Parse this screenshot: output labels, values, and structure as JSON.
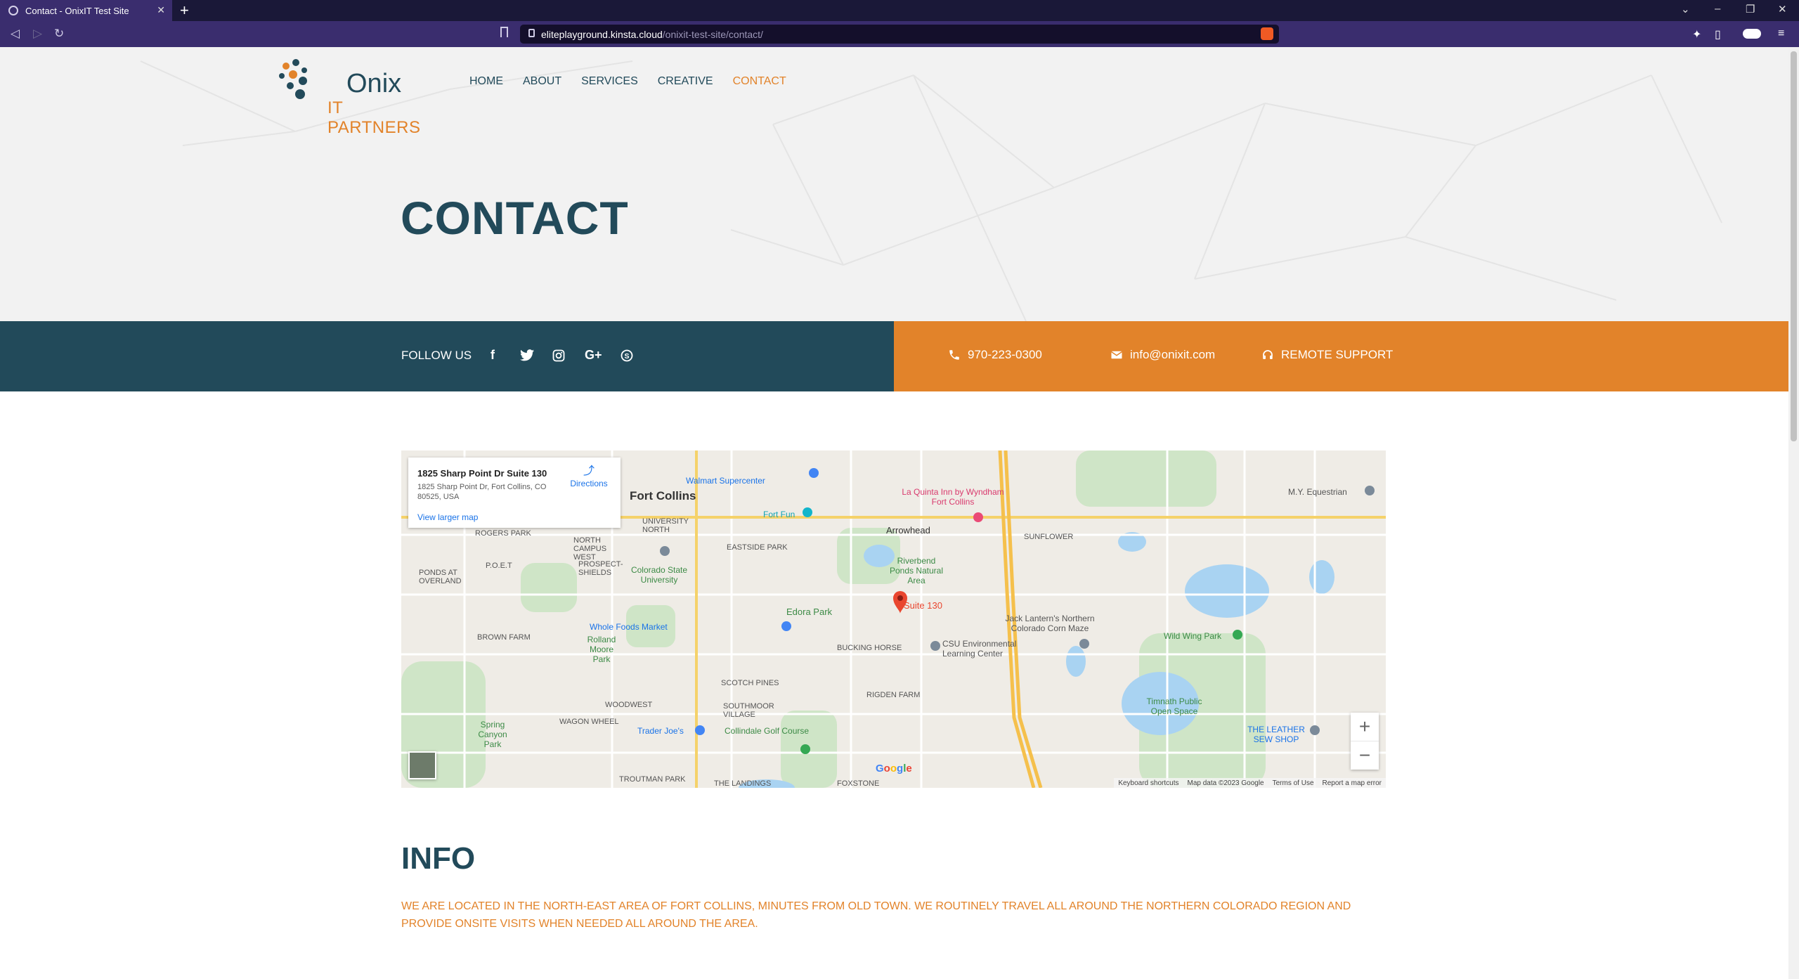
{
  "browser": {
    "tab_title": "Contact - OnixIT Test Site",
    "url_domain": "eliteplayground.kinsta.cloud",
    "url_path": "/onixit-test-site/contact/"
  },
  "logo": {
    "name": "Onix",
    "tagline": "IT PARTNERS"
  },
  "nav": [
    {
      "label": "HOME"
    },
    {
      "label": "ABOUT"
    },
    {
      "label": "SERVICES"
    },
    {
      "label": "CREATIVE"
    },
    {
      "label": "CONTACT"
    }
  ],
  "hero": {
    "title": "CONTACT"
  },
  "follow_bar": {
    "label": "FOLLOW US",
    "social_icons": [
      "facebook-icon",
      "twitter-icon",
      "instagram-icon",
      "google-plus-icon",
      "skype-icon"
    ]
  },
  "contact_bar": {
    "phone": "970-223-0300",
    "email": "info@onixit.com",
    "remote": "REMOTE SUPPORT"
  },
  "map": {
    "place_title": "1825 Sharp Point Dr Suite 130",
    "place_address": "1825 Sharp Point Dr, Fort Collins, CO 80525, USA",
    "directions": "Directions",
    "view_larger": "View larger map",
    "marker_label": "Suite 130",
    "attribution": [
      "Keyboard shortcuts",
      "Map data ©2023 Google",
      "Terms of Use",
      "Report a map error"
    ],
    "labels": [
      {
        "text": "Fort Collins"
      },
      {
        "text": "ROGERS PARK"
      },
      {
        "text": "UNIVERSITY NORTH"
      },
      {
        "text": "Walmart Supercenter"
      },
      {
        "text": "La Quinta Inn by Wyndham Fort Collins"
      },
      {
        "text": "M.Y. Equestrian"
      },
      {
        "text": "Fort Fun"
      },
      {
        "text": "Arrowhead"
      },
      {
        "text": "SUNFLOWER"
      },
      {
        "text": "NORTH CAMPUS WEST"
      },
      {
        "text": "EASTSIDE PARK"
      },
      {
        "text": "Riverbend Ponds Natural Area"
      },
      {
        "text": "P.O.E.T"
      },
      {
        "text": "PROSPECT-SHIELDS"
      },
      {
        "text": "Colorado State University"
      },
      {
        "text": "PONDS AT OVERLAND"
      },
      {
        "text": "Edora Park"
      },
      {
        "text": "Jack Lantern's Northern Colorado Corn Maze"
      },
      {
        "text": "Wild Wing Park"
      },
      {
        "text": "Whole Foods Market"
      },
      {
        "text": "BROWN FARM"
      },
      {
        "text": "Rolland Moore Park"
      },
      {
        "text": "BUCKING HORSE"
      },
      {
        "text": "CSU Environmental Learning Center"
      },
      {
        "text": "SCOTCH PINES"
      },
      {
        "text": "RIGDEN FARM"
      },
      {
        "text": "WOODWEST"
      },
      {
        "text": "SOUTHMOOR VILLAGE"
      },
      {
        "text": "WAGON WHEEL"
      },
      {
        "text": "Timnath Public Open Space"
      },
      {
        "text": "Spring Canyon Park"
      },
      {
        "text": "Trader Joe's"
      },
      {
        "text": "Collindale Golf Course"
      },
      {
        "text": "THE LEATHER SEW SHOP"
      },
      {
        "text": "TROUTMAN PARK"
      },
      {
        "text": "THE LANDINGS"
      },
      {
        "text": "FOXSTONE"
      }
    ]
  },
  "info": {
    "title": "INFO",
    "text": "WE ARE LOCATED IN THE NORTH-EAST AREA OF FORT COLLINS, MINUTES FROM OLD TOWN. WE ROUTINELY TRAVEL ALL AROUND THE NORTHERN COLORADO REGION AND PROVIDE ONSITE VISITS WHEN NEEDED ALL AROUND THE AREA."
  },
  "colors": {
    "brand_dark": "#224a5a",
    "brand_orange": "#e2832a"
  }
}
